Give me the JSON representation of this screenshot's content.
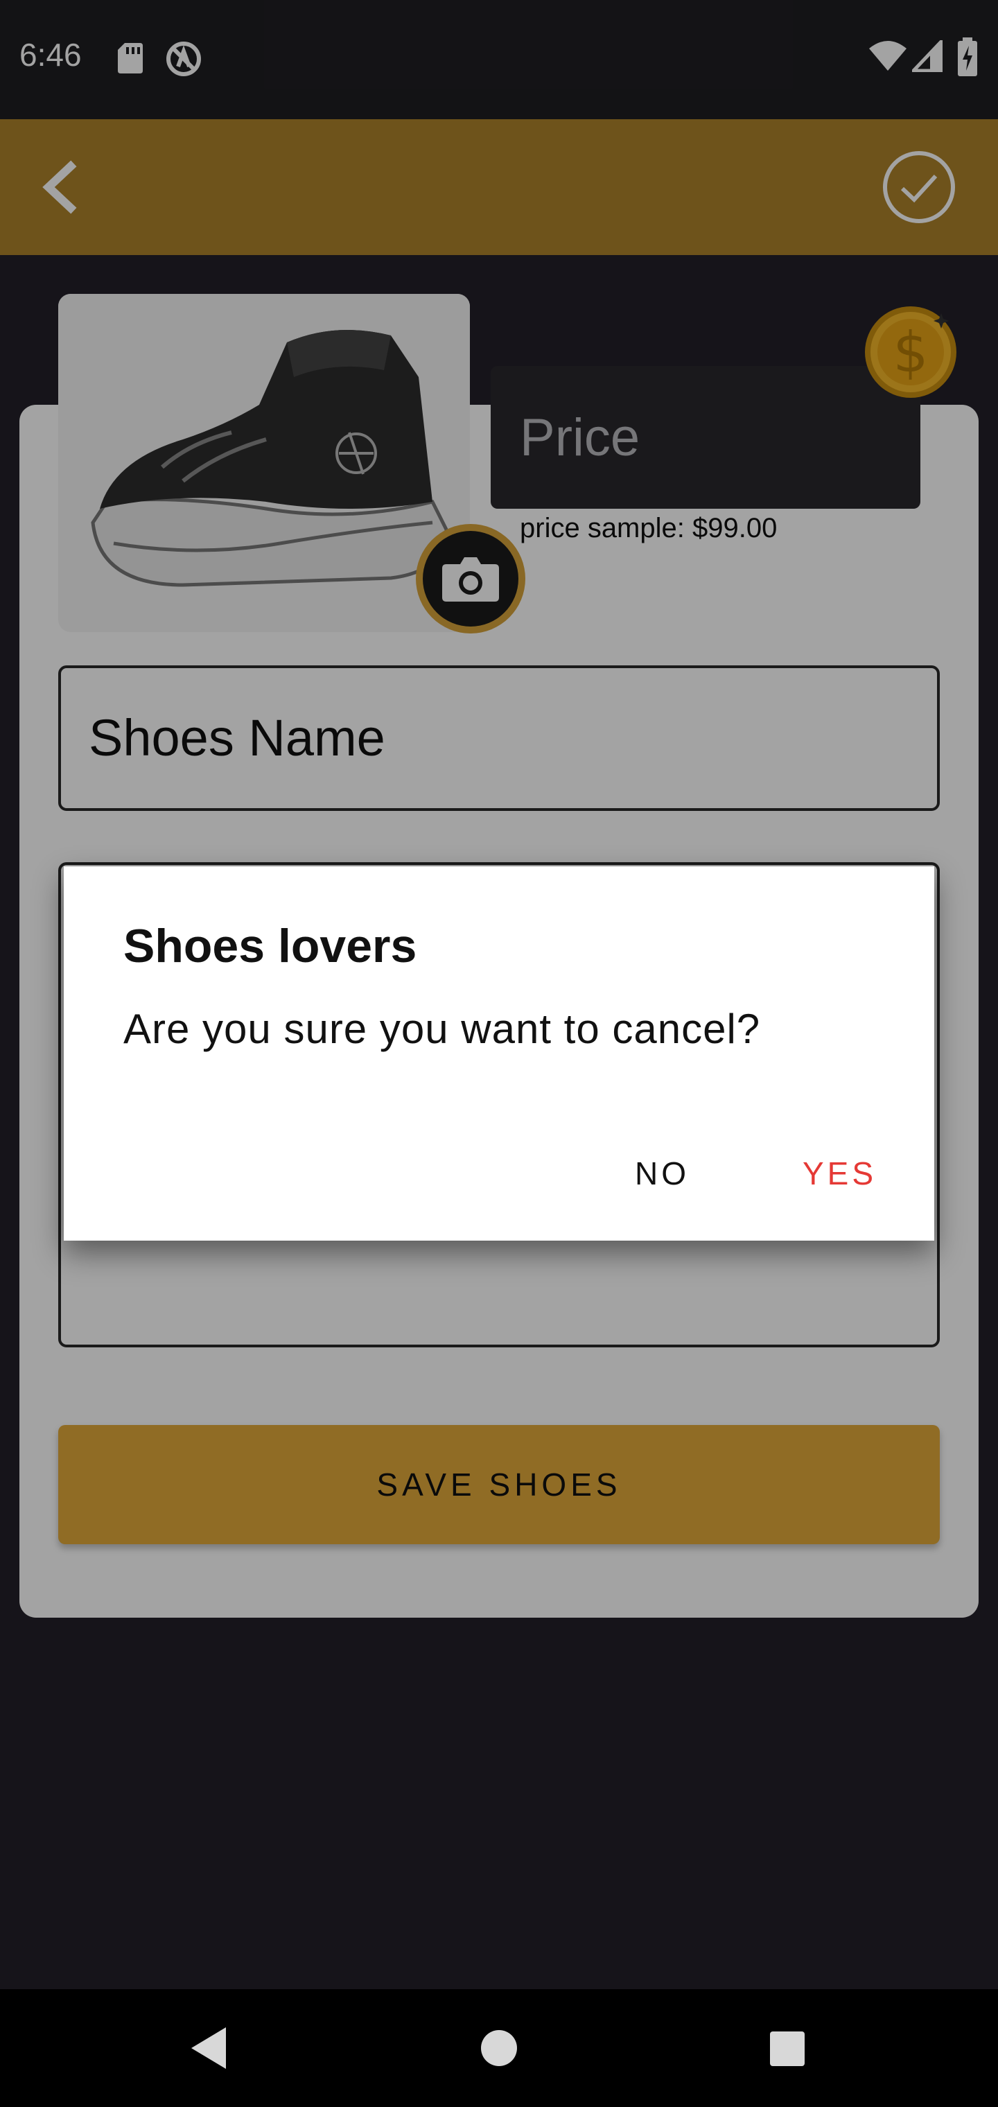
{
  "status_bar": {
    "time": "6:46",
    "left_icons": [
      "sd-card-icon",
      "do-not-disturb-icon"
    ],
    "right_icons": [
      "wifi-icon",
      "signal-icon",
      "battery-charging-icon"
    ]
  },
  "app_bar": {
    "back_icon": "chevron-left-icon",
    "confirm_icon": "check-circle-icon",
    "color": "#ad832b"
  },
  "form": {
    "image_placeholder_icon": "shoe-image",
    "camera_icon": "camera-icon",
    "price_placeholder": "Price",
    "price_helper": "price sample: $99.00",
    "coin_icon": "dollar-coin-icon",
    "name_placeholder": "Shoes Name",
    "save_label": "SAVE SHOES",
    "accent": "#e2a93b"
  },
  "dialog": {
    "title": "Shoes lovers",
    "message": "Are you sure you want to cancel?",
    "no_label": "NO",
    "yes_label": "YES",
    "yes_color": "#e53935"
  },
  "nav_bar": {
    "icons": [
      "back-triangle-icon",
      "home-circle-icon",
      "recents-square-icon"
    ]
  }
}
